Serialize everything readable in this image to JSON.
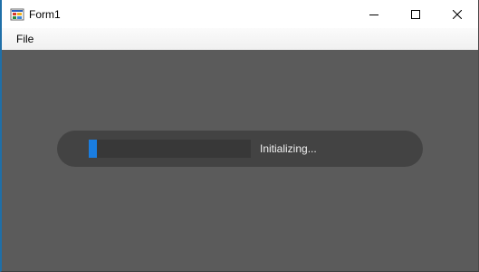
{
  "window": {
    "title": "Form1",
    "icon": "winforms-app-icon",
    "controls": {
      "minimize": "minimize-icon",
      "maximize": "maximize-icon",
      "close": "close-icon"
    }
  },
  "menu": {
    "items": [
      {
        "label": "File"
      }
    ]
  },
  "loader": {
    "status": "Initializing...",
    "progress": 0.05,
    "colors": {
      "pill": "#434343",
      "track": "#383838",
      "fill": "#1a7de0",
      "text": "#f0f0f0"
    }
  },
  "colors": {
    "client_background": "#5b5b5b"
  }
}
